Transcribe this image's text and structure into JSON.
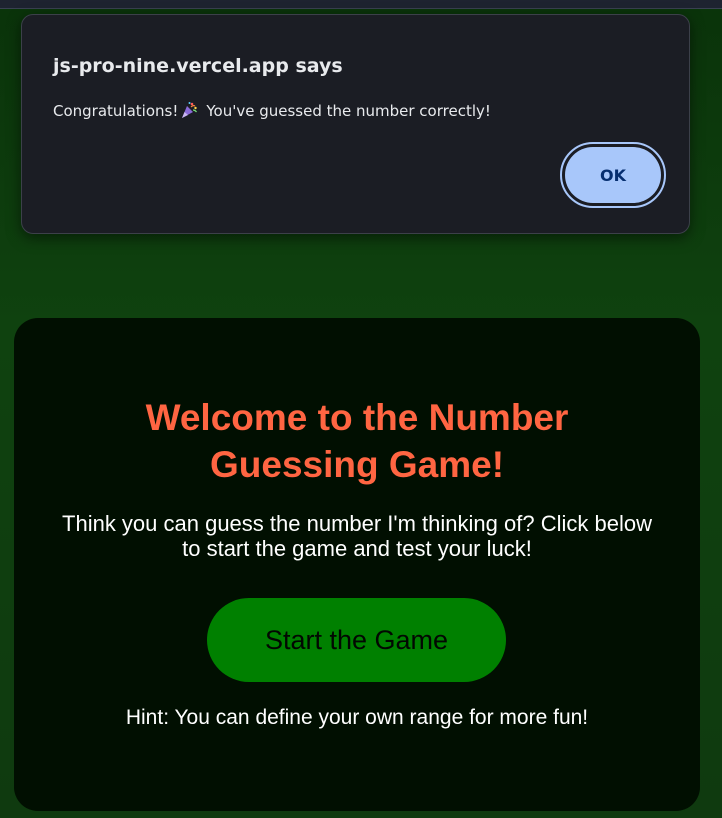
{
  "dialog": {
    "title": "js-pro-nine.vercel.app says",
    "message_before_icon": "Congratulations!",
    "message_icon": "party-popper-icon",
    "message_after_icon": "You've guessed the number correctly!",
    "ok_label": "OK"
  },
  "game": {
    "title_line1": "Welcome to the Number",
    "title_line2": "Guessing Game!",
    "description": "Think you can guess the number I'm thinking of? Click below to start the game and test your luck!",
    "start_label": "Start the Game",
    "hint": "Hint: You can define your own range for more fun!"
  },
  "colors": {
    "page_background": "#0f420f",
    "card_background": "#010f01",
    "title_accent": "#ff6542",
    "start_button": "#008000",
    "dialog_background": "#1b1d24",
    "ok_button": "#a8c7fa"
  }
}
